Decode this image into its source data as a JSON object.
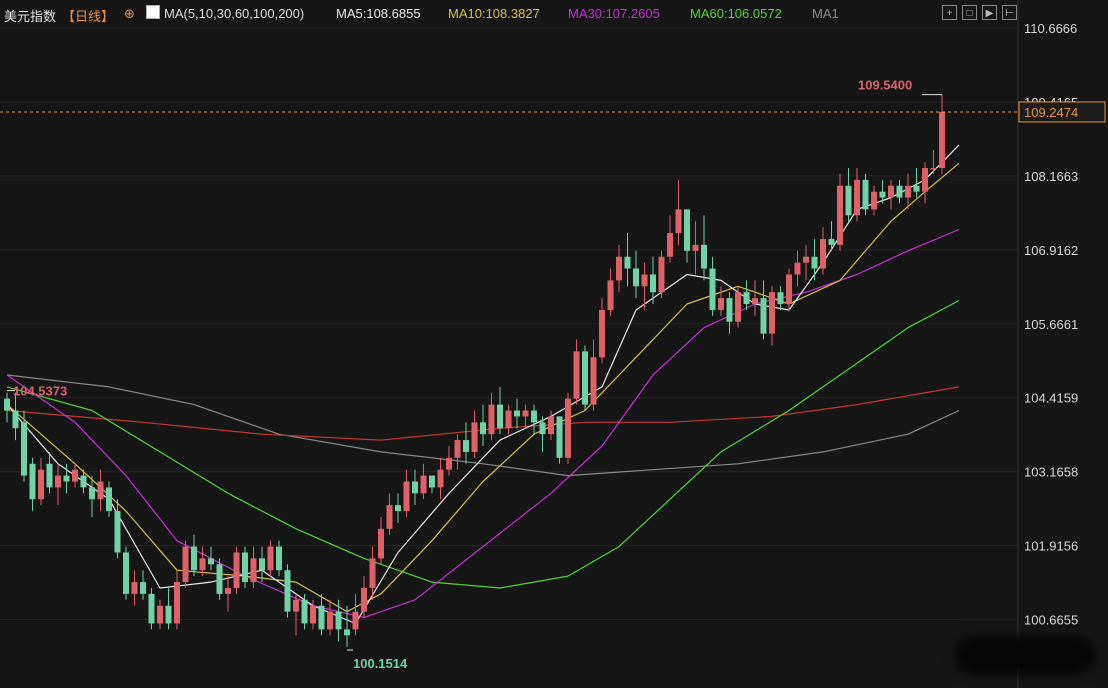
{
  "header": {
    "symbol": "美元指数",
    "period": "【日线】",
    "lock_icon": "⊕",
    "ma_icon": "chart-icon",
    "ma_def": "MA(5,10,30,60,100,200)",
    "ma5": "MA5:108.6855",
    "ma10": "MA10:108.3827",
    "ma30": "MA30:107.2605",
    "ma60": "MA60:106.0572",
    "ma1": "MA1",
    "controls": [
      "+",
      "□",
      "▶",
      "⊢"
    ]
  },
  "colors": {
    "up": "#e0606a",
    "down": "#6fd3a6",
    "ma5": "#e8e8e8",
    "ma10": "#d8c14a",
    "ma30": "#c234d0",
    "ma60": "#56d436",
    "ma100": "#c23a30",
    "ma200": "#8a8a8a",
    "price_line": "#e89a3a",
    "label_high": "#d8636d",
    "label_low": "#6fd3a6"
  },
  "chart_data": {
    "type": "candlestick",
    "y_ticks": [
      "110.6666",
      "109.4165",
      "108.1663",
      "106.9162",
      "105.6661",
      "104.4159",
      "103.1658",
      "101.9156",
      "100.6655"
    ],
    "ylim": [
      100.1514,
      110.6666
    ],
    "current_price": "109.2474",
    "high_label": "109.5400",
    "low_label": "100.1514",
    "start_label": "104.5373",
    "candles": [
      [
        104.4,
        104.5,
        104.0,
        104.2
      ],
      [
        104.2,
        104.5,
        103.7,
        103.9
      ],
      [
        104.0,
        104.2,
        103.0,
        103.1
      ],
      [
        103.3,
        103.4,
        102.5,
        102.7
      ],
      [
        102.7,
        103.4,
        102.6,
        103.2
      ],
      [
        103.3,
        103.5,
        102.8,
        102.9
      ],
      [
        102.9,
        103.3,
        102.6,
        103.1
      ],
      [
        103.1,
        103.3,
        102.8,
        103.0
      ],
      [
        103.0,
        103.3,
        102.9,
        103.2
      ],
      [
        103.1,
        103.2,
        102.8,
        102.9
      ],
      [
        102.9,
        103.1,
        102.4,
        102.7
      ],
      [
        102.7,
        103.2,
        102.5,
        103.0
      ],
      [
        102.9,
        103.0,
        102.4,
        102.5
      ],
      [
        102.5,
        102.7,
        101.7,
        101.8
      ],
      [
        101.8,
        101.9,
        101.0,
        101.1
      ],
      [
        101.1,
        101.5,
        100.9,
        101.3
      ],
      [
        101.3,
        101.5,
        101.0,
        101.1
      ],
      [
        101.1,
        101.2,
        100.5,
        100.6
      ],
      [
        100.6,
        101.0,
        100.5,
        100.9
      ],
      [
        100.9,
        101.2,
        100.5,
        100.6
      ],
      [
        100.6,
        101.5,
        100.5,
        101.3
      ],
      [
        101.3,
        102.0,
        101.2,
        101.9
      ],
      [
        101.9,
        102.1,
        101.4,
        101.5
      ],
      [
        101.5,
        101.9,
        101.4,
        101.7
      ],
      [
        101.7,
        101.9,
        101.5,
        101.6
      ],
      [
        101.6,
        101.7,
        101.0,
        101.1
      ],
      [
        101.1,
        101.4,
        100.8,
        101.2
      ],
      [
        101.2,
        101.9,
        101.1,
        101.8
      ],
      [
        101.8,
        101.9,
        101.2,
        101.3
      ],
      [
        101.3,
        101.9,
        101.2,
        101.7
      ],
      [
        101.7,
        101.9,
        101.3,
        101.5
      ],
      [
        101.5,
        102.0,
        101.4,
        101.9
      ],
      [
        101.9,
        102.0,
        101.4,
        101.5
      ],
      [
        101.5,
        101.6,
        100.7,
        100.8
      ],
      [
        100.8,
        101.1,
        100.4,
        101.0
      ],
      [
        101.0,
        101.1,
        100.5,
        100.6
      ],
      [
        100.6,
        101.0,
        100.5,
        100.9
      ],
      [
        100.9,
        101.1,
        100.4,
        100.5
      ],
      [
        100.5,
        101.0,
        100.4,
        100.8
      ],
      [
        100.8,
        101.0,
        100.3,
        100.5
      ],
      [
        100.5,
        100.9,
        100.2,
        100.4
      ],
      [
        100.5,
        101.1,
        100.4,
        100.8
      ],
      [
        100.8,
        101.4,
        100.7,
        101.2
      ],
      [
        101.2,
        101.9,
        101.0,
        101.7
      ],
      [
        101.7,
        102.4,
        101.6,
        102.2
      ],
      [
        102.2,
        102.8,
        102.1,
        102.6
      ],
      [
        102.6,
        102.8,
        102.3,
        102.5
      ],
      [
        102.5,
        103.2,
        102.4,
        103.0
      ],
      [
        103.0,
        103.2,
        102.6,
        102.8
      ],
      [
        102.8,
        103.3,
        102.7,
        103.1
      ],
      [
        103.1,
        103.1,
        102.8,
        102.9
      ],
      [
        102.9,
        103.4,
        102.7,
        103.2
      ],
      [
        103.2,
        103.6,
        103.1,
        103.4
      ],
      [
        103.4,
        103.8,
        103.2,
        103.7
      ],
      [
        103.7,
        104.0,
        103.3,
        103.5
      ],
      [
        103.5,
        104.2,
        103.4,
        104.0
      ],
      [
        104.0,
        104.3,
        103.6,
        103.8
      ],
      [
        103.8,
        104.5,
        103.7,
        104.3
      ],
      [
        104.3,
        104.6,
        103.8,
        103.9
      ],
      [
        103.9,
        104.3,
        103.8,
        104.2
      ],
      [
        104.2,
        104.4,
        103.9,
        104.1
      ],
      [
        104.1,
        104.3,
        103.9,
        104.2
      ],
      [
        104.2,
        104.3,
        103.8,
        104.0
      ],
      [
        104.0,
        104.1,
        103.5,
        103.8
      ],
      [
        103.8,
        104.2,
        103.7,
        104.1
      ],
      [
        104.1,
        104.1,
        103.3,
        103.4
      ],
      [
        103.4,
        104.5,
        103.3,
        104.4
      ],
      [
        104.4,
        105.4,
        104.3,
        105.2
      ],
      [
        105.2,
        105.3,
        104.2,
        104.3
      ],
      [
        104.3,
        105.4,
        104.2,
        105.1
      ],
      [
        105.1,
        106.1,
        105.0,
        105.9
      ],
      [
        105.9,
        106.6,
        105.8,
        106.4
      ],
      [
        106.4,
        107.0,
        106.2,
        106.8
      ],
      [
        106.8,
        107.2,
        106.3,
        106.6
      ],
      [
        106.6,
        106.9,
        106.1,
        106.3
      ],
      [
        106.3,
        106.7,
        105.9,
        106.5
      ],
      [
        106.5,
        106.8,
        106.0,
        106.2
      ],
      [
        106.2,
        106.9,
        106.1,
        106.8
      ],
      [
        106.8,
        107.5,
        106.7,
        107.2
      ],
      [
        107.2,
        108.1,
        107.0,
        107.6
      ],
      [
        107.6,
        107.6,
        106.7,
        106.9
      ],
      [
        106.9,
        107.4,
        106.5,
        107.0
      ],
      [
        107.0,
        107.5,
        106.4,
        106.6
      ],
      [
        106.6,
        106.8,
        105.8,
        105.9
      ],
      [
        105.9,
        106.3,
        105.8,
        106.1
      ],
      [
        106.1,
        106.2,
        105.5,
        105.7
      ],
      [
        105.7,
        106.3,
        105.6,
        106.2
      ],
      [
        106.2,
        106.4,
        105.9,
        106.0
      ],
      [
        106.0,
        106.4,
        105.8,
        106.1
      ],
      [
        106.1,
        106.4,
        105.4,
        105.5
      ],
      [
        105.5,
        106.3,
        105.3,
        106.2
      ],
      [
        106.2,
        106.3,
        105.9,
        106.0
      ],
      [
        106.0,
        106.6,
        105.9,
        106.5
      ],
      [
        106.5,
        106.9,
        106.3,
        106.7
      ],
      [
        106.7,
        107.0,
        106.4,
        106.8
      ],
      [
        106.8,
        107.1,
        106.4,
        106.6
      ],
      [
        106.6,
        107.3,
        106.5,
        107.1
      ],
      [
        107.1,
        107.4,
        106.9,
        107.0
      ],
      [
        107.0,
        108.2,
        106.9,
        108.0
      ],
      [
        108.0,
        108.3,
        107.4,
        107.5
      ],
      [
        107.5,
        108.3,
        107.4,
        108.1
      ],
      [
        108.1,
        108.2,
        107.5,
        107.6
      ],
      [
        107.6,
        108.0,
        107.5,
        107.9
      ],
      [
        107.9,
        108.1,
        107.7,
        107.8
      ],
      [
        107.8,
        108.1,
        107.6,
        108.0
      ],
      [
        108.0,
        108.1,
        107.7,
        107.8
      ],
      [
        107.8,
        108.2,
        107.6,
        108.0
      ],
      [
        108.0,
        108.3,
        107.8,
        107.9
      ],
      [
        107.9,
        108.4,
        107.7,
        108.3
      ],
      [
        108.3,
        108.6,
        108.2,
        108.3
      ],
      [
        108.3,
        109.54,
        108.2,
        109.2474
      ]
    ],
    "ma": {
      "ma5": [
        [
          0,
          104.3
        ],
        [
          6,
          103.3
        ],
        [
          12,
          102.7
        ],
        [
          18,
          101.2
        ],
        [
          24,
          101.3
        ],
        [
          30,
          101.5
        ],
        [
          36,
          100.9
        ],
        [
          41,
          100.6
        ],
        [
          46,
          101.8
        ],
        [
          52,
          102.8
        ],
        [
          58,
          103.7
        ],
        [
          64,
          104.1
        ],
        [
          70,
          104.6
        ],
        [
          74,
          105.9
        ],
        [
          80,
          106.5
        ],
        [
          84,
          106.4
        ],
        [
          88,
          106.0
        ],
        [
          92,
          105.9
        ],
        [
          96,
          106.7
        ],
        [
          100,
          107.6
        ],
        [
          104,
          107.8
        ],
        [
          108,
          108.1
        ],
        [
          112,
          108.69
        ]
      ],
      "ma10": [
        [
          0,
          104.3
        ],
        [
          8,
          103.3
        ],
        [
          14,
          102.5
        ],
        [
          20,
          101.5
        ],
        [
          28,
          101.4
        ],
        [
          34,
          101.3
        ],
        [
          40,
          100.8
        ],
        [
          44,
          101.1
        ],
        [
          50,
          102.0
        ],
        [
          56,
          103.0
        ],
        [
          62,
          103.8
        ],
        [
          68,
          104.2
        ],
        [
          74,
          105.1
        ],
        [
          80,
          106.0
        ],
        [
          86,
          106.3
        ],
        [
          92,
          106.0
        ],
        [
          98,
          106.4
        ],
        [
          104,
          107.4
        ],
        [
          108,
          107.9
        ],
        [
          112,
          108.38
        ]
      ],
      "ma30": [
        [
          0,
          104.8
        ],
        [
          8,
          104.0
        ],
        [
          14,
          103.1
        ],
        [
          20,
          102.0
        ],
        [
          28,
          101.4
        ],
        [
          36,
          100.9
        ],
        [
          42,
          100.7
        ],
        [
          48,
          101.0
        ],
        [
          56,
          101.9
        ],
        [
          64,
          102.8
        ],
        [
          70,
          103.6
        ],
        [
          76,
          104.8
        ],
        [
          82,
          105.6
        ],
        [
          88,
          106.0
        ],
        [
          94,
          106.2
        ],
        [
          100,
          106.5
        ],
        [
          106,
          106.9
        ],
        [
          112,
          107.26
        ]
      ],
      "ma60": [
        [
          0,
          104.6
        ],
        [
          10,
          104.2
        ],
        [
          18,
          103.5
        ],
        [
          26,
          102.8
        ],
        [
          34,
          102.2
        ],
        [
          42,
          101.7
        ],
        [
          50,
          101.3
        ],
        [
          58,
          101.2
        ],
        [
          66,
          101.4
        ],
        [
          72,
          101.9
        ],
        [
          78,
          102.7
        ],
        [
          84,
          103.5
        ],
        [
          92,
          104.2
        ],
        [
          100,
          105.0
        ],
        [
          106,
          105.6
        ],
        [
          112,
          106.06
        ]
      ],
      "ma100": [
        [
          0,
          104.2
        ],
        [
          16,
          104.0
        ],
        [
          30,
          103.8
        ],
        [
          44,
          103.7
        ],
        [
          58,
          103.9
        ],
        [
          68,
          104.0
        ],
        [
          78,
          104.0
        ],
        [
          90,
          104.1
        ],
        [
          100,
          104.3
        ],
        [
          112,
          104.6
        ]
      ],
      "ma200": [
        [
          0,
          104.8
        ],
        [
          12,
          104.6
        ],
        [
          22,
          104.3
        ],
        [
          32,
          103.8
        ],
        [
          44,
          103.5
        ],
        [
          56,
          103.3
        ],
        [
          66,
          103.1
        ],
        [
          76,
          103.2
        ],
        [
          86,
          103.3
        ],
        [
          96,
          103.5
        ],
        [
          106,
          103.8
        ],
        [
          112,
          104.2
        ]
      ]
    }
  }
}
